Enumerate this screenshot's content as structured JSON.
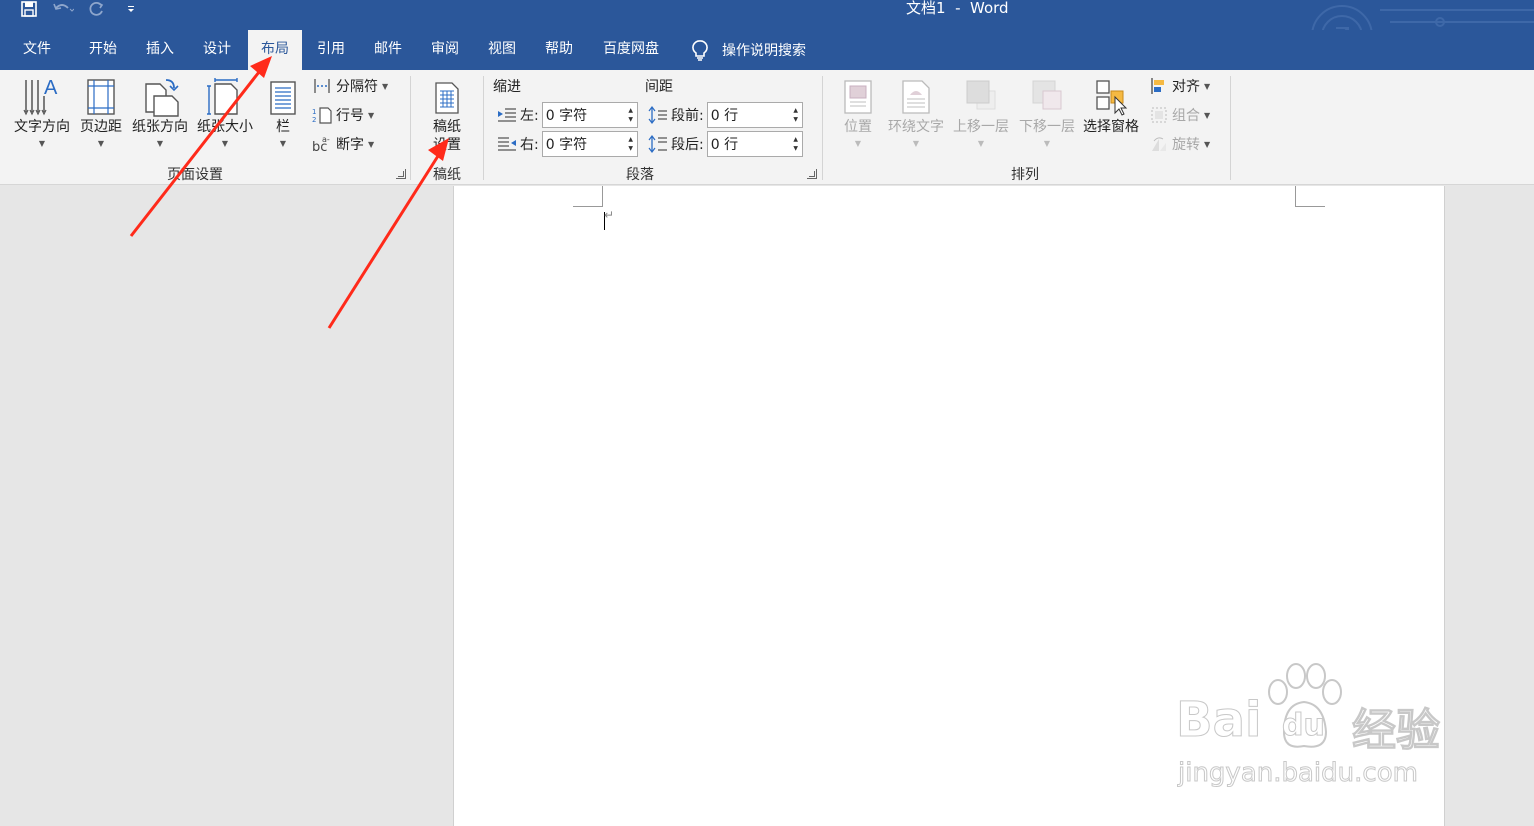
{
  "window": {
    "title": "文档1  -  Word"
  },
  "tabs": [
    {
      "label": "文件"
    },
    {
      "label": "开始"
    },
    {
      "label": "插入"
    },
    {
      "label": "设计"
    },
    {
      "label": "布局",
      "active": true
    },
    {
      "label": "引用"
    },
    {
      "label": "邮件"
    },
    {
      "label": "审阅"
    },
    {
      "label": "视图"
    },
    {
      "label": "帮助"
    },
    {
      "label": "百度网盘"
    }
  ],
  "tell_me": {
    "label": "操作说明搜索",
    "icon": "lightbulb-icon"
  },
  "ribbon": {
    "page_setup": {
      "label": "页面设置",
      "text_direction": "文字方向",
      "margins": "页边距",
      "orientation": "纸张方向",
      "size": "纸张大小",
      "columns": "栏",
      "breaks": "分隔符",
      "line_numbers": "行号",
      "hyphenation": "断字"
    },
    "manuscript": {
      "label": "稿纸",
      "settings_line1": "稿纸",
      "settings_line2": "设置"
    },
    "paragraph": {
      "label": "段落",
      "indent_head": "缩进",
      "spacing_head": "间距",
      "left_label": "左:",
      "left_value": "0 字符",
      "right_label": "右:",
      "right_value": "0 字符",
      "before_label": "段前:",
      "before_value": "0 行",
      "after_label": "段后:",
      "after_value": "0 行"
    },
    "arrange": {
      "label": "排列",
      "position": "位置",
      "wrap_text": "环绕文字",
      "bring_forward": "上移一层",
      "send_backward": "下移一层",
      "selection_pane": "选择窗格",
      "align": "对齐",
      "group": "组合",
      "rotate": "旋转"
    }
  },
  "watermark": {
    "brand_main": "Bai",
    "brand_du": "du",
    "brand_cn": "经验",
    "url": "jingyan.baidu.com"
  },
  "colors": {
    "title_bar": "#2b579a",
    "ribbon_bg": "#f3f3f3",
    "annotation_arrow": "#ff2a1a"
  }
}
